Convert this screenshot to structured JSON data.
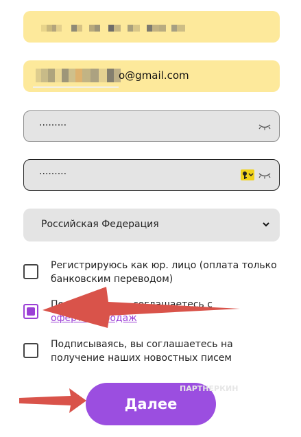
{
  "form": {
    "name_field": {
      "value": ""
    },
    "email_field": {
      "value_suffix": "o@gmail.com"
    },
    "password_field": {
      "value": "·········"
    },
    "confirm_password_field": {
      "value": "·········"
    },
    "country_select": {
      "selected": "Российская Федерация"
    },
    "checkboxes": [
      {
        "label": "Регистрируюсь как юр. лицо (оплата только банковским переводом)",
        "checked": false
      },
      {
        "label_prefix": "Подп",
        "label_suffix": "соглашаетесь с",
        "link": "офертой продаж",
        "checked": true
      },
      {
        "label": "Подписываясь, вы соглашаетесь на получение наших новостных писем",
        "checked": false
      }
    ],
    "submit_label": "Далее"
  },
  "annotations": {
    "arrow_color": "#d9534a",
    "arrows": [
      "arrow-to-offer-checkbox",
      "arrow-to-next-button"
    ]
  },
  "watermark": "ПАРТНЕРКИН",
  "colors": {
    "accent": "#9b4ee0",
    "input_yellow": "#fde99b",
    "input_grey": "#e4e4e4",
    "key_badge": "#f1d21a"
  }
}
